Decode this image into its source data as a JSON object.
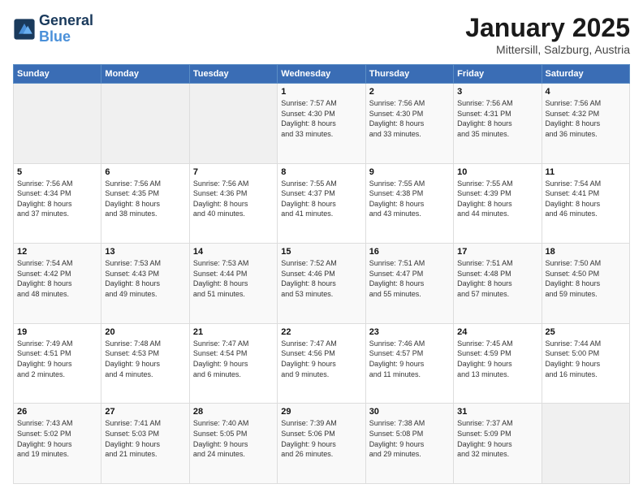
{
  "logo": {
    "line1": "General",
    "line2": "Blue"
  },
  "header": {
    "title": "January 2025",
    "subtitle": "Mittersill, Salzburg, Austria"
  },
  "days_of_week": [
    "Sunday",
    "Monday",
    "Tuesday",
    "Wednesday",
    "Thursday",
    "Friday",
    "Saturday"
  ],
  "weeks": [
    [
      {
        "day": "",
        "info": ""
      },
      {
        "day": "",
        "info": ""
      },
      {
        "day": "",
        "info": ""
      },
      {
        "day": "1",
        "info": "Sunrise: 7:57 AM\nSunset: 4:30 PM\nDaylight: 8 hours\nand 33 minutes."
      },
      {
        "day": "2",
        "info": "Sunrise: 7:56 AM\nSunset: 4:30 PM\nDaylight: 8 hours\nand 33 minutes."
      },
      {
        "day": "3",
        "info": "Sunrise: 7:56 AM\nSunset: 4:31 PM\nDaylight: 8 hours\nand 35 minutes."
      },
      {
        "day": "4",
        "info": "Sunrise: 7:56 AM\nSunset: 4:32 PM\nDaylight: 8 hours\nand 36 minutes."
      }
    ],
    [
      {
        "day": "5",
        "info": "Sunrise: 7:56 AM\nSunset: 4:34 PM\nDaylight: 8 hours\nand 37 minutes."
      },
      {
        "day": "6",
        "info": "Sunrise: 7:56 AM\nSunset: 4:35 PM\nDaylight: 8 hours\nand 38 minutes."
      },
      {
        "day": "7",
        "info": "Sunrise: 7:56 AM\nSunset: 4:36 PM\nDaylight: 8 hours\nand 40 minutes."
      },
      {
        "day": "8",
        "info": "Sunrise: 7:55 AM\nSunset: 4:37 PM\nDaylight: 8 hours\nand 41 minutes."
      },
      {
        "day": "9",
        "info": "Sunrise: 7:55 AM\nSunset: 4:38 PM\nDaylight: 8 hours\nand 43 minutes."
      },
      {
        "day": "10",
        "info": "Sunrise: 7:55 AM\nSunset: 4:39 PM\nDaylight: 8 hours\nand 44 minutes."
      },
      {
        "day": "11",
        "info": "Sunrise: 7:54 AM\nSunset: 4:41 PM\nDaylight: 8 hours\nand 46 minutes."
      }
    ],
    [
      {
        "day": "12",
        "info": "Sunrise: 7:54 AM\nSunset: 4:42 PM\nDaylight: 8 hours\nand 48 minutes."
      },
      {
        "day": "13",
        "info": "Sunrise: 7:53 AM\nSunset: 4:43 PM\nDaylight: 8 hours\nand 49 minutes."
      },
      {
        "day": "14",
        "info": "Sunrise: 7:53 AM\nSunset: 4:44 PM\nDaylight: 8 hours\nand 51 minutes."
      },
      {
        "day": "15",
        "info": "Sunrise: 7:52 AM\nSunset: 4:46 PM\nDaylight: 8 hours\nand 53 minutes."
      },
      {
        "day": "16",
        "info": "Sunrise: 7:51 AM\nSunset: 4:47 PM\nDaylight: 8 hours\nand 55 minutes."
      },
      {
        "day": "17",
        "info": "Sunrise: 7:51 AM\nSunset: 4:48 PM\nDaylight: 8 hours\nand 57 minutes."
      },
      {
        "day": "18",
        "info": "Sunrise: 7:50 AM\nSunset: 4:50 PM\nDaylight: 8 hours\nand 59 minutes."
      }
    ],
    [
      {
        "day": "19",
        "info": "Sunrise: 7:49 AM\nSunset: 4:51 PM\nDaylight: 9 hours\nand 2 minutes."
      },
      {
        "day": "20",
        "info": "Sunrise: 7:48 AM\nSunset: 4:53 PM\nDaylight: 9 hours\nand 4 minutes."
      },
      {
        "day": "21",
        "info": "Sunrise: 7:47 AM\nSunset: 4:54 PM\nDaylight: 9 hours\nand 6 minutes."
      },
      {
        "day": "22",
        "info": "Sunrise: 7:47 AM\nSunset: 4:56 PM\nDaylight: 9 hours\nand 9 minutes."
      },
      {
        "day": "23",
        "info": "Sunrise: 7:46 AM\nSunset: 4:57 PM\nDaylight: 9 hours\nand 11 minutes."
      },
      {
        "day": "24",
        "info": "Sunrise: 7:45 AM\nSunset: 4:59 PM\nDaylight: 9 hours\nand 13 minutes."
      },
      {
        "day": "25",
        "info": "Sunrise: 7:44 AM\nSunset: 5:00 PM\nDaylight: 9 hours\nand 16 minutes."
      }
    ],
    [
      {
        "day": "26",
        "info": "Sunrise: 7:43 AM\nSunset: 5:02 PM\nDaylight: 9 hours\nand 19 minutes."
      },
      {
        "day": "27",
        "info": "Sunrise: 7:41 AM\nSunset: 5:03 PM\nDaylight: 9 hours\nand 21 minutes."
      },
      {
        "day": "28",
        "info": "Sunrise: 7:40 AM\nSunset: 5:05 PM\nDaylight: 9 hours\nand 24 minutes."
      },
      {
        "day": "29",
        "info": "Sunrise: 7:39 AM\nSunset: 5:06 PM\nDaylight: 9 hours\nand 26 minutes."
      },
      {
        "day": "30",
        "info": "Sunrise: 7:38 AM\nSunset: 5:08 PM\nDaylight: 9 hours\nand 29 minutes."
      },
      {
        "day": "31",
        "info": "Sunrise: 7:37 AM\nSunset: 5:09 PM\nDaylight: 9 hours\nand 32 minutes."
      },
      {
        "day": "",
        "info": ""
      }
    ]
  ]
}
